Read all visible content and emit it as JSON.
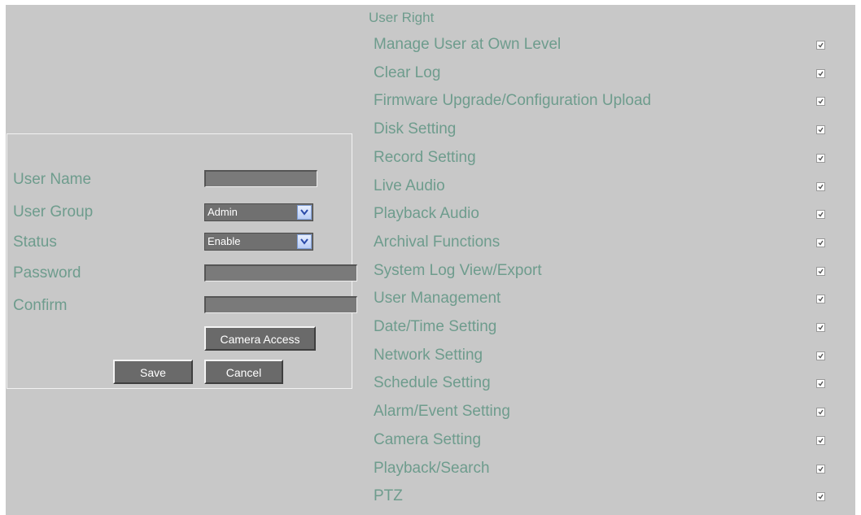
{
  "form": {
    "user_name_label": "User Name",
    "user_name_value": "",
    "user_group_label": "User Group",
    "user_group_value": "Admin",
    "status_label": "Status",
    "status_value": "Enable",
    "password_label": "Password",
    "password_value": "",
    "confirm_label": "Confirm",
    "confirm_value": "",
    "camera_access_label": "Camera Access",
    "save_label": "Save",
    "cancel_label": "Cancel"
  },
  "rights": {
    "title": "User Right",
    "items": [
      {
        "label": "Manage User at Own Level",
        "checked": true
      },
      {
        "label": "Clear Log",
        "checked": true
      },
      {
        "label": "Firmware Upgrade/Configuration Upload",
        "checked": true
      },
      {
        "label": "Disk Setting",
        "checked": true
      },
      {
        "label": "Record Setting",
        "checked": true
      },
      {
        "label": "Live Audio",
        "checked": true
      },
      {
        "label": "Playback Audio",
        "checked": true
      },
      {
        "label": "Archival Functions",
        "checked": true
      },
      {
        "label": "System Log View/Export",
        "checked": true
      },
      {
        "label": "User Management",
        "checked": true
      },
      {
        "label": "Date/Time Setting",
        "checked": true
      },
      {
        "label": "Network Setting",
        "checked": true
      },
      {
        "label": "Schedule Setting",
        "checked": true
      },
      {
        "label": "Alarm/Event Setting",
        "checked": true
      },
      {
        "label": "Camera Setting",
        "checked": true
      },
      {
        "label": "Playback/Search",
        "checked": true
      },
      {
        "label": "PTZ",
        "checked": true
      }
    ]
  },
  "colors": {
    "background": "#c8c8c8",
    "label_text": "#6e9c8d",
    "control_fill": "#6a6a6a"
  }
}
